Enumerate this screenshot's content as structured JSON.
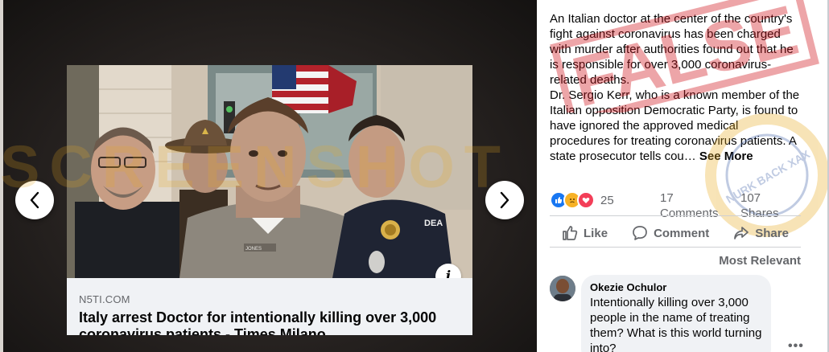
{
  "viewer": {
    "watermark_text": "SCREENSHOT BY",
    "link_preview": {
      "domain": "N5TI.COM",
      "headline": "Italy arrest Doctor for intentionally killing over 3,000 coronavirus patients - Times Milano",
      "info_glyph": "i"
    },
    "photo": {
      "badge_text": "DEA",
      "name_tag": "JONES"
    },
    "icons": {
      "prev": "chevron-left-icon",
      "next": "chevron-right-icon",
      "info": "info-icon"
    }
  },
  "post": {
    "paragraph_1": "An Italian doctor at the center of the country's fight against coronavirus has been charged with murder after authorities found out that he is responsible for over 3,000 coronavirus-related deaths.",
    "paragraph_2_main": "Dr. Sergio Kerr, who is a known member of the Italian opposition Democratic Party, is found to have ignored the approved medical procedures for treating coronavirus patients. A state prosecutor tells cou… ",
    "see_more": "See More",
    "reaction_count": "25",
    "comments_count": "17 Comments",
    "shares_count": "107 Shares",
    "actions": {
      "like": "Like",
      "comment": "Comment",
      "share": "Share"
    },
    "sort_label": "Most Relevant",
    "stamps": {
      "false": "FALSE",
      "ribbon": "NURK BACK XAX"
    },
    "colors": {
      "like_blue": "#1877f2",
      "love_red": "#f33e58",
      "sad_yellow": "#f7b125",
      "stamp_red": "#d0151d",
      "watermark": "#e8aa1e"
    }
  },
  "comment": {
    "author": "Okezie Ochulor",
    "text": "Intentionally killing over 3,000 people in the name of treating them? What is this world turning into?",
    "options": "•••"
  }
}
